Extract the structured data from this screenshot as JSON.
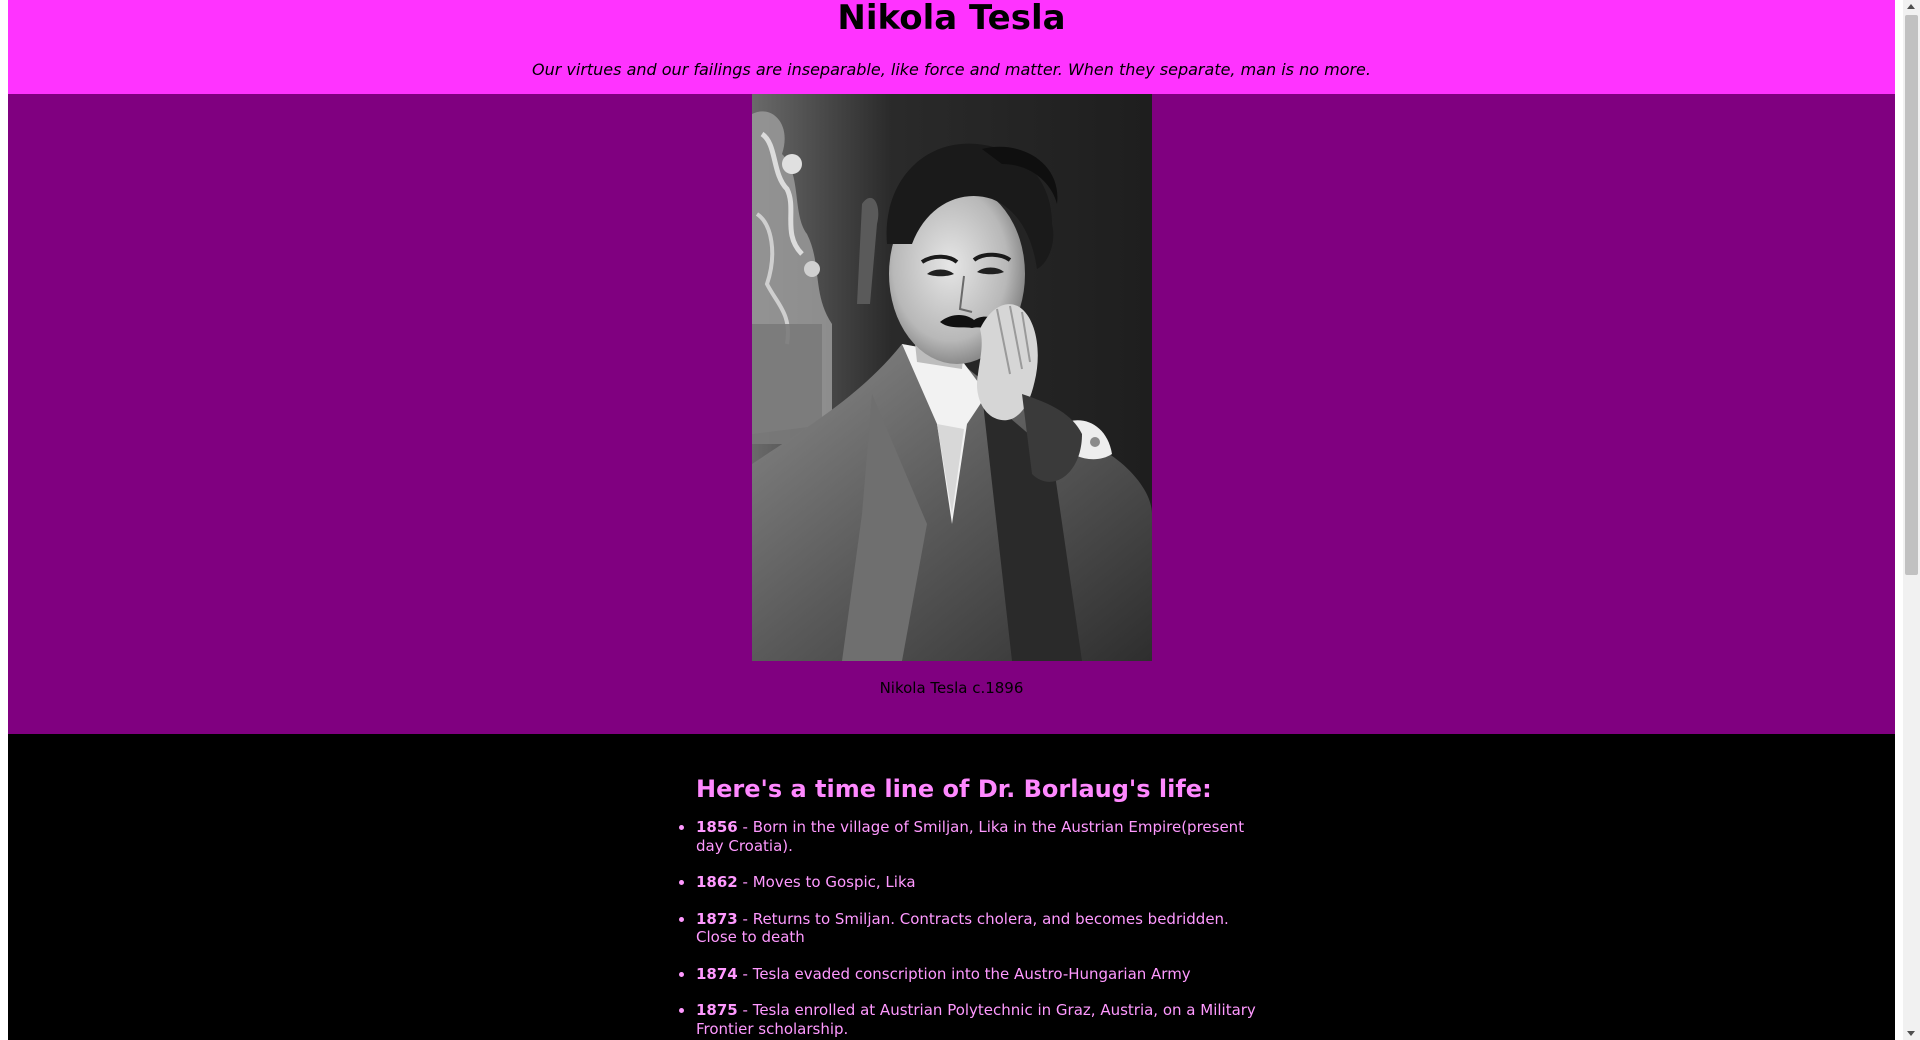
{
  "header": {
    "title": "Nikola Tesla",
    "quote": "Our virtues and our failings are inseparable, like force and matter. When they separate, man is no more."
  },
  "image_section": {
    "portrait_icon": "portrait-photo",
    "caption": "Nikola Tesla c.1896"
  },
  "timeline": {
    "heading": "Here's a time line of Dr. Borlaug's life:",
    "items": [
      {
        "year": "1856",
        "text": " - Born in the village of Smiljan, Lika in the Austrian Empire(present day Croatia)."
      },
      {
        "year": "1862",
        "text": " - Moves to Gospic, Lika"
      },
      {
        "year": "1873",
        "text": " - Returns to Smiljan. Contracts cholera, and becomes bedridden. Close to death"
      },
      {
        "year": "1874",
        "text": " - Tesla evaded conscription into the Austro-Hungarian Army"
      },
      {
        "year": "1875",
        "text": " - Tesla enrolled at Austrian Polytechnic in Graz, Austria, on a Military Frontier scholarship."
      }
    ]
  },
  "colors": {
    "header_bg": "#ff33ff",
    "image_section_bg": "#800080",
    "timeline_bg": "#000000",
    "timeline_text": "#ff99ff"
  }
}
